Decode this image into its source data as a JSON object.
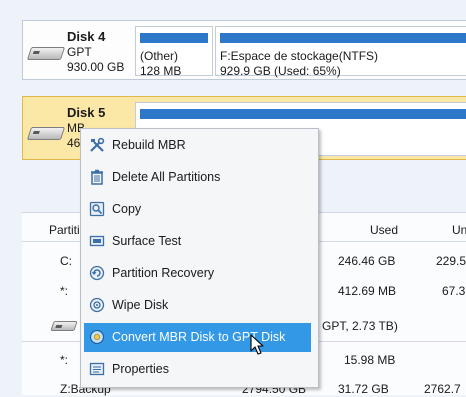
{
  "disks": [
    {
      "name": "Disk 4",
      "type": "GPT",
      "size": "930.00 GB",
      "partitions": [
        {
          "label": "(Other)",
          "detail": "128 MB"
        },
        {
          "label": "F:Espace de stockage(NTFS)",
          "detail": "929.9 GB (Used: 65%)"
        }
      ]
    },
    {
      "name": "Disk 5",
      "type": "MB",
      "size": "46",
      "selected": true
    }
  ],
  "table": {
    "headers": {
      "partition": "Partiti",
      "used": "Used",
      "unused": "Un"
    },
    "rows": [
      {
        "name": "C:",
        "used": "246.46 GB",
        "unused": "229.5"
      },
      {
        "name": "*:",
        "used": "412.69 MB",
        "unused": "67.3"
      },
      {
        "name": "",
        "info": "GPT, 2.73 TB)",
        "disk_row": true
      },
      {
        "name": "*:",
        "used": "15.98 MB",
        "unused": ""
      },
      {
        "name": "Z:Backup",
        "capacity": "2794.50 GB",
        "used": "31.72 GB",
        "unused": "2762.7"
      }
    ]
  },
  "context_menu": {
    "items": [
      {
        "label": "Rebuild MBR",
        "icon": "tools-icon"
      },
      {
        "label": "Delete All Partitions",
        "icon": "trash-icon"
      },
      {
        "label": "Copy",
        "icon": "copy-icon"
      },
      {
        "label": "Surface Test",
        "icon": "surface-test-icon"
      },
      {
        "label": "Partition Recovery",
        "icon": "recovery-icon"
      },
      {
        "label": "Wipe Disk",
        "icon": "wipe-icon"
      },
      {
        "label": "Convert MBR Disk to GPT Disk",
        "icon": "convert-icon",
        "highlighted": true
      },
      {
        "label": "Properties",
        "icon": "properties-icon"
      }
    ]
  },
  "colors": {
    "accent": "#3399e6",
    "bar": "#2d78c8",
    "selected_row": "#fbe7a6"
  }
}
